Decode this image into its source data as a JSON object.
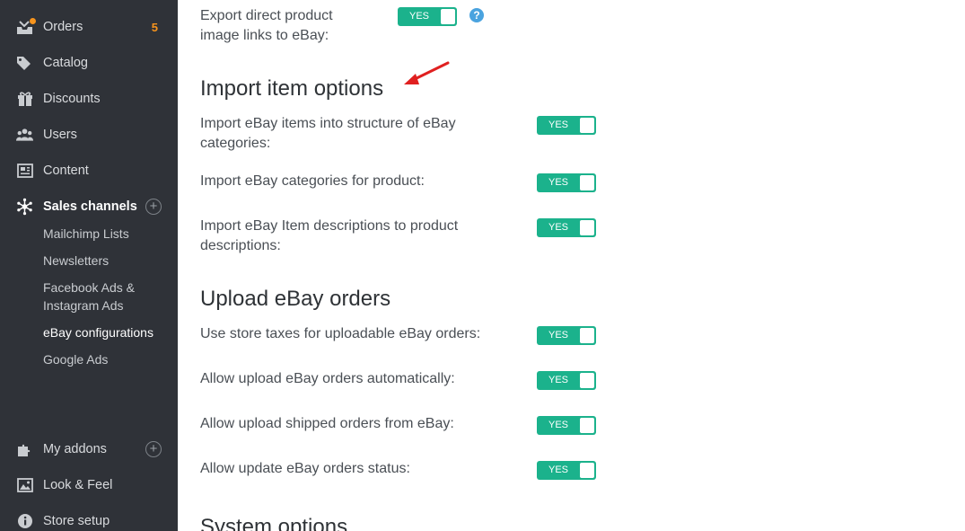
{
  "sidebar": {
    "items": [
      {
        "label": "Orders",
        "icon": "orders-icon",
        "badge": "5"
      },
      {
        "label": "Catalog",
        "icon": "tag-icon"
      },
      {
        "label": "Discounts",
        "icon": "gift-icon"
      },
      {
        "label": "Users",
        "icon": "users-icon"
      },
      {
        "label": "Content",
        "icon": "newspaper-icon"
      },
      {
        "label": "Sales channels",
        "icon": "network-icon"
      },
      {
        "label": "My addons",
        "icon": "puzzle-icon"
      },
      {
        "label": "Look & Feel",
        "icon": "image-icon"
      },
      {
        "label": "Store setup",
        "icon": "info-icon"
      }
    ],
    "sales_channels_sub": [
      "Mailchimp Lists",
      "Newsletters",
      "Facebook Ads & Instagram Ads",
      "eBay configurations",
      "Google Ads"
    ],
    "plus": "+"
  },
  "main": {
    "export_label": "Export direct product image links to eBay:",
    "help": "?",
    "import_title": "Import item options",
    "import_options": [
      "Import eBay items into structure of eBay categories:",
      "Import eBay categories for product:",
      "Import eBay Item descriptions to product descriptions:"
    ],
    "upload_title": "Upload eBay orders",
    "upload_options": [
      "Use store taxes for uploadable eBay orders:",
      "Allow upload eBay orders automatically:",
      "Allow upload shipped orders from eBay:",
      "Allow update eBay orders status:"
    ],
    "system_title": "System options",
    "toggle_text": "YES"
  },
  "colors": {
    "sidebar_bg": "#2f3238",
    "toggle": "#1bb28c",
    "badge": "#f7941d",
    "arrow": "#e02020"
  }
}
